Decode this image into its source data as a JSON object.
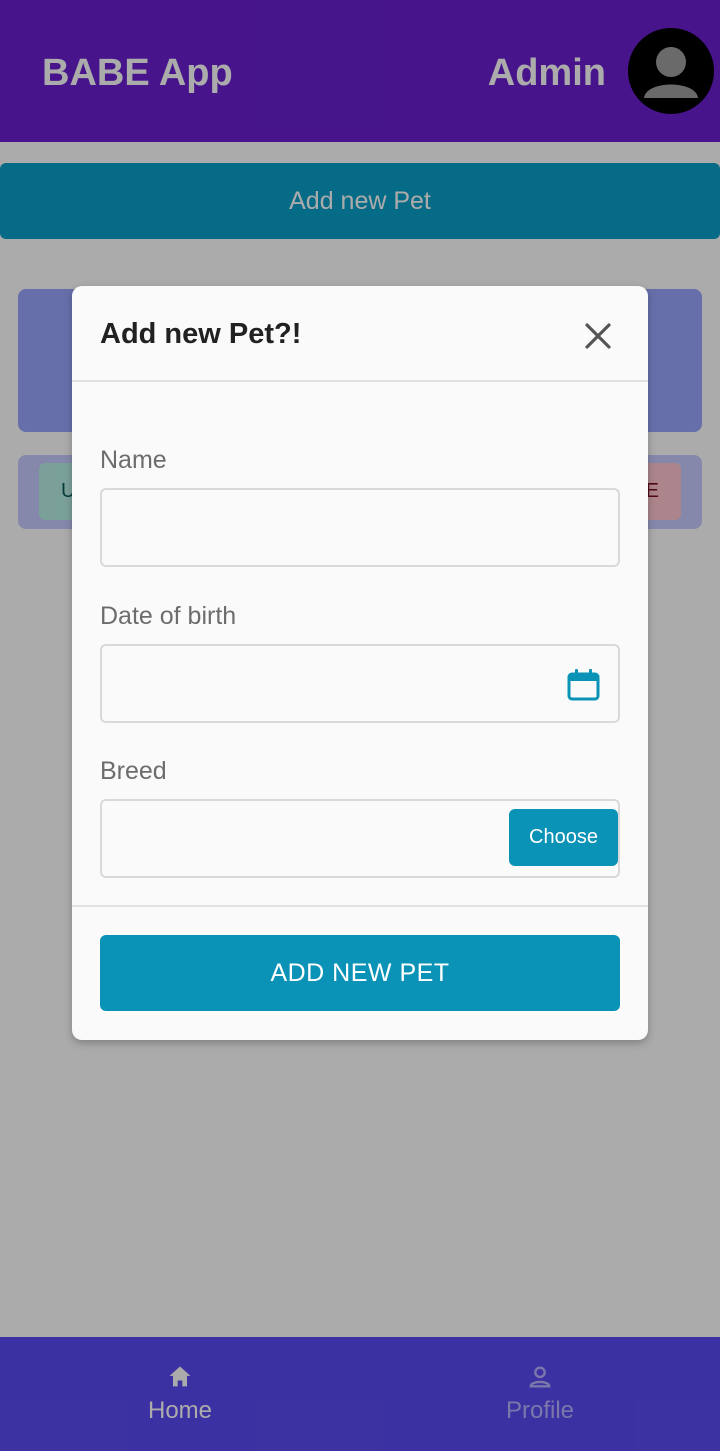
{
  "header": {
    "app_title": "BABE App",
    "user_label": "Admin"
  },
  "main": {
    "add_pet_button": "Add new Pet",
    "row_left_partial": "U",
    "row_right_partial": "E"
  },
  "modal": {
    "title": "Add new Pet?!",
    "fields": {
      "name_label": "Name",
      "name_value": "",
      "dob_label": "Date of birth",
      "dob_value": "",
      "breed_label": "Breed",
      "breed_value": ""
    },
    "choose_button": "Choose",
    "submit_button": "ADD NEW PET"
  },
  "bottom_nav": {
    "items": [
      {
        "label": "Home",
        "icon": "home-icon",
        "active": true
      },
      {
        "label": "Profile",
        "icon": "person-icon",
        "active": false
      }
    ]
  },
  "colors": {
    "topbar": "#6a1fd0",
    "accent": "#0b93b7",
    "bottom_nav": "#5a4af2",
    "scrim": "rgba(0,0,0,0.33)"
  }
}
